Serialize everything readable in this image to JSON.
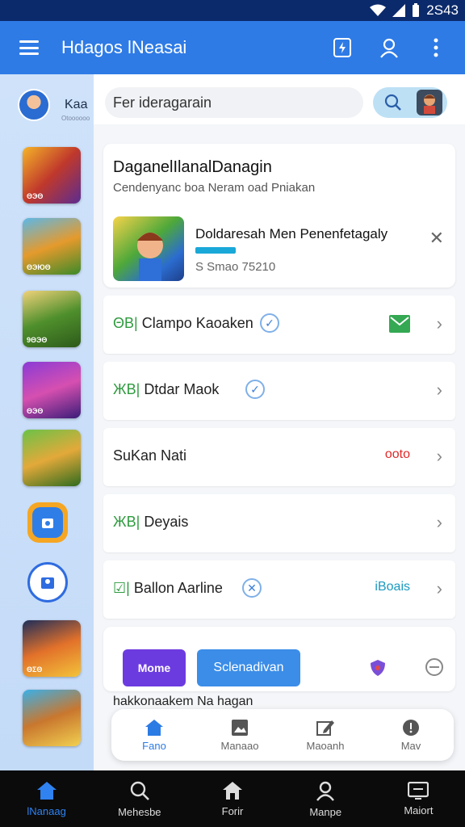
{
  "status": {
    "time": "2S43"
  },
  "appbar": {
    "title": "Hdagos lNeasai"
  },
  "sidebar": {
    "profile_name": "Kaa",
    "profile_sub": "Otoooooo",
    "thumbs": [
      "ΘЭΘ",
      "ΘЭЮΘ",
      "9ΘЭΘ",
      "ΘЭΘ",
      "",
      "ΘΣΘ",
      ""
    ]
  },
  "search": {
    "placeholder": "Fer ideragarain"
  },
  "header": {
    "title": "DaganelIlanalDanagin",
    "subtitle": "Cendenyanc boa Neram oad Pniakan",
    "game_title": "Doldaresah Men Penenfetagaly",
    "game_meta": "S Smao 75210"
  },
  "rows": [
    {
      "prefix": "ΘB|",
      "label": "Clampo Kaoaken",
      "right_kind": "mail"
    },
    {
      "prefix": "ЖB|",
      "label": "Dtdar Maok",
      "right_kind": ""
    },
    {
      "prefix": "",
      "label": "SuKan Nati",
      "right_text": "ooto",
      "right_color": "#e02828"
    },
    {
      "prefix": "ЖB|",
      "label": "Deyais",
      "right_kind": ""
    },
    {
      "prefix": "☑|",
      "label": "Ballon Aarline",
      "right_text": "iBoais",
      "right_color": "#1a9ac0"
    }
  ],
  "actions": {
    "pill_primary": "Mome",
    "pill_secondary": "Sclenadivan"
  },
  "bottom_text": "hakkonaakem Na hagan",
  "subnav": [
    {
      "label": "Fano",
      "icon": "home-icon"
    },
    {
      "label": "Manaao",
      "icon": "image-icon"
    },
    {
      "label": "Maoanh",
      "icon": "edit-icon"
    },
    {
      "label": "Mav",
      "icon": "info-icon"
    }
  ],
  "bottomnav": [
    {
      "label": "lNanaag",
      "icon": "home-icon"
    },
    {
      "label": "Mehesbe",
      "icon": "search-icon"
    },
    {
      "label": "Forir",
      "icon": "house-icon"
    },
    {
      "label": "Manpe",
      "icon": "user-icon"
    },
    {
      "label": "Maiort",
      "icon": "tv-icon"
    }
  ],
  "colors": {
    "appbar": "#2e7be6",
    "accent": "#2b7be4",
    "status": "#0b2a6b"
  }
}
